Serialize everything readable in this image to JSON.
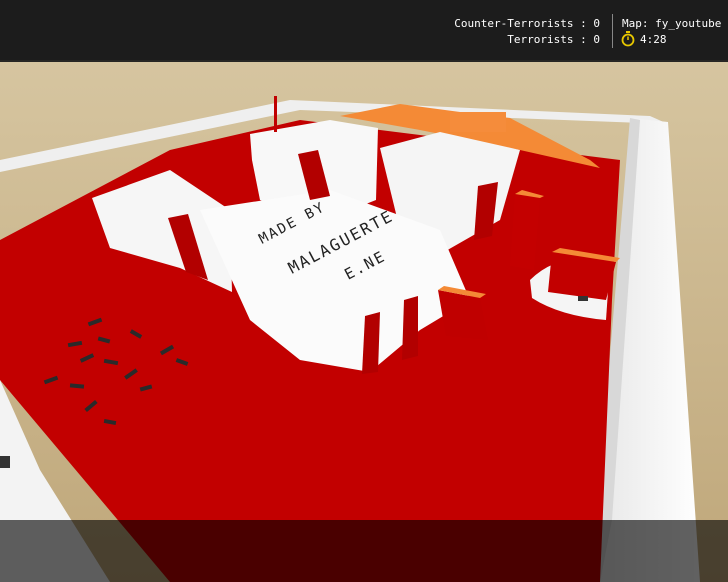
{
  "scene": {
    "description_icon": "cs-map-view",
    "map_graffiti": {
      "line1": "MADE BY",
      "line2": "MALAGUERTE",
      "line3": "E.NE"
    }
  },
  "hud": {
    "ct_score": "Counter-Terrorists : 0",
    "t_score": "Terrorists : 0",
    "map": "Map: fy_youtube",
    "timer": "4:28",
    "timer_icon": "stopwatch-icon"
  },
  "colors": {
    "floor_red": "#c00000",
    "wall_white": "#f4f4f4",
    "accent_orange": "#f5893a",
    "sand": "#cdb98c",
    "timer_yellow": "#e8c800"
  }
}
